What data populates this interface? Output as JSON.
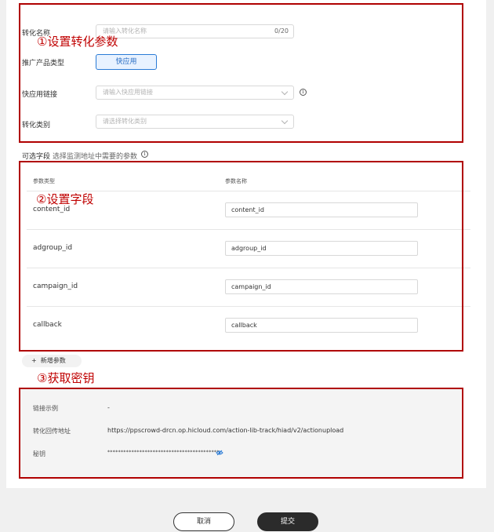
{
  "form": {
    "conversion_name_label": "转化名称",
    "conversion_name_placeholder": "请输入转化名称",
    "conversion_name_counter": "0/20",
    "product_type_label": "推广产品类型",
    "product_type_button": "快应用",
    "quickapp_link_label": "快应用链接",
    "quickapp_link_placeholder": "请输入快应用链接",
    "conversion_category_label": "转化类别",
    "conversion_category_placeholder": "请选择转化类别"
  },
  "optional_fields": {
    "label": "可选字段",
    "hint": "选择监测地址中需要的参数",
    "col_param_type": "参数类型",
    "col_param_name": "参数名称",
    "rows": [
      {
        "name": "content_id",
        "value": "content_id"
      },
      {
        "name": "adgroup_id",
        "value": "adgroup_id"
      },
      {
        "name": "campaign_id",
        "value": "campaign_id"
      },
      {
        "name": "callback",
        "value": "callback"
      }
    ],
    "add_param_label": "新增参数"
  },
  "key_panel": {
    "link_example_label": "链接示例",
    "link_example_value": "-",
    "callback_label": "转化回传地址",
    "callback_value": "https://ppscrowd-drcn.op.hicloud.com/action-lib-track/hiad/v2/actionupload",
    "secret_label": "秘钥",
    "secret_value": "******************************************"
  },
  "annotations": {
    "step1": "①设置转化参数",
    "step2": "②设置字段",
    "step3": "③获取密钥"
  },
  "footer": {
    "cancel": "取消",
    "submit": "提交"
  },
  "colors": {
    "annotation_red": "#c00000",
    "primary_blue": "#2a7bd6",
    "submit_dark": "#2b2b2b"
  }
}
